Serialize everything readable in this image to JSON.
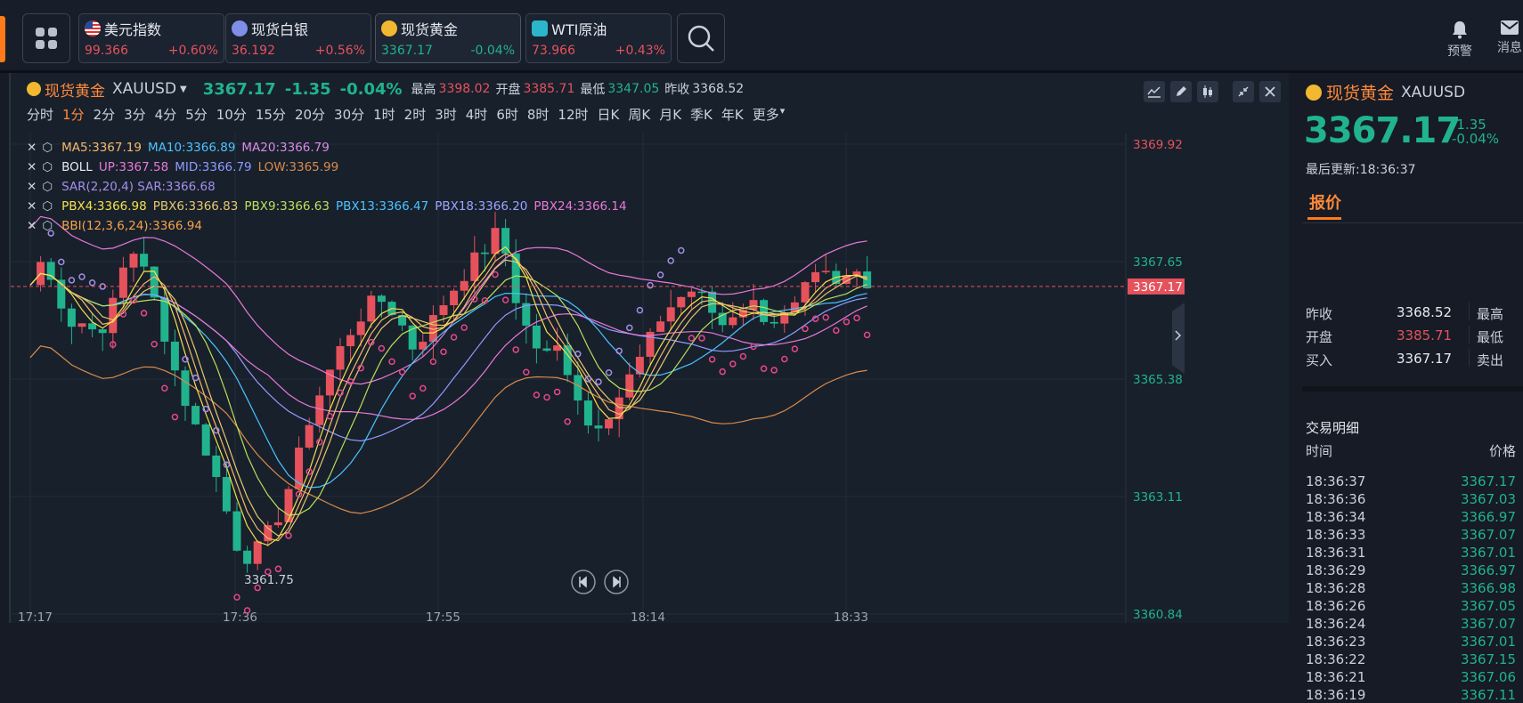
{
  "topbar": {
    "quotes": [
      {
        "name": "美元指数",
        "price": "99.366",
        "change": "+0.60%",
        "icon": "us-flag-icon"
      },
      {
        "name": "现货白银",
        "price": "36.192",
        "change": "+0.56%",
        "icon": "silver-icon"
      },
      {
        "name": "现货黄金",
        "price": "3367.17",
        "change": "-0.04%",
        "icon": "gold-icon"
      },
      {
        "name": "WTI原油",
        "price": "73.966",
        "change": "+0.43%",
        "icon": "oil-icon"
      }
    ],
    "alert_label": "预警",
    "message_label": "消息"
  },
  "chart_header": {
    "name": "现货黄金",
    "code": "XAUUSD",
    "price": "3367.17",
    "change": "-1.35",
    "change_pct": "-0.04%",
    "high_label": "最高",
    "high": "3398.02",
    "open_label": "开盘",
    "open": "3385.71",
    "low_label": "最低",
    "low": "3347.05",
    "prev_label": "昨收",
    "prev": "3368.52"
  },
  "periods": [
    "分时",
    "1分",
    "2分",
    "3分",
    "4分",
    "5分",
    "10分",
    "15分",
    "20分",
    "30分",
    "1时",
    "2时",
    "3时",
    "4时",
    "6时",
    "8时",
    "12时",
    "日K",
    "周K",
    "月K",
    "季K",
    "年K",
    "更多"
  ],
  "active_period": "1分",
  "indicators": {
    "ma": [
      "MA5:3367.19",
      "MA10:3366.89",
      "MA20:3366.79"
    ],
    "boll_name": "BOLL",
    "boll": [
      "UP:3367.58",
      "MID:3366.79",
      "LOW:3365.99"
    ],
    "sar": "SAR(2,20,4) SAR:3366.68",
    "pbx": [
      "PBX4:3366.98",
      "PBX6:3366.83",
      "PBX9:3366.63",
      "PBX13:3366.47",
      "PBX18:3366.20",
      "PBX24:3366.14"
    ],
    "bbi": "BBI(12,3,6,24):3366.94"
  },
  "colors": {
    "up": "#e6525c",
    "down": "#21b38d",
    "accent": "#ff8a3a"
  },
  "chart_data": {
    "type": "candlestick",
    "y_ticks": [
      "3369.92",
      "3367.65",
      "3365.38",
      "3363.11",
      "3360.84"
    ],
    "x_ticks": [
      "17:17",
      "17:36",
      "17:55",
      "18:14",
      "18:33"
    ],
    "last_price_tag": "3367.17",
    "min_label": "3361.75",
    "ylim": [
      3360.84,
      3369.92
    ]
  },
  "right": {
    "name": "现货黄金",
    "code": "XAUUSD",
    "price": "3367.17",
    "change": "-1.35",
    "change_pct": "-0.04%",
    "updated": "最后更新:18:36:37",
    "tab": "报价",
    "quote_rows": [
      {
        "k": "昨收",
        "v": "3368.52",
        "k2": "最高"
      },
      {
        "k": "开盘",
        "v": "3385.71",
        "k2": "最低"
      },
      {
        "k": "买入",
        "v": "3367.17",
        "k2": "卖出"
      }
    ],
    "trades_title": "交易明细",
    "time_header": "时间",
    "price_header": "价格",
    "trades": [
      {
        "t": "18:36:37",
        "p": "3367.17"
      },
      {
        "t": "18:36:36",
        "p": "3367.03"
      },
      {
        "t": "18:36:34",
        "p": "3366.97"
      },
      {
        "t": "18:36:33",
        "p": "3367.07"
      },
      {
        "t": "18:36:31",
        "p": "3367.01"
      },
      {
        "t": "18:36:29",
        "p": "3366.97"
      },
      {
        "t": "18:36:28",
        "p": "3366.98"
      },
      {
        "t": "18:36:26",
        "p": "3367.05"
      },
      {
        "t": "18:36:24",
        "p": "3367.07"
      },
      {
        "t": "18:36:23",
        "p": "3367.01"
      },
      {
        "t": "18:36:22",
        "p": "3367.15"
      },
      {
        "t": "18:36:21",
        "p": "3367.06"
      },
      {
        "t": "18:36:19",
        "p": "3367.11"
      }
    ]
  }
}
